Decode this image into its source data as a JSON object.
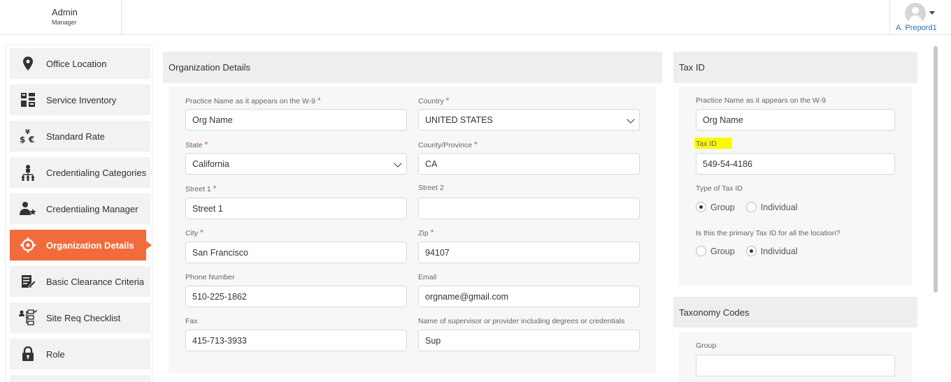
{
  "header": {
    "app_title": "Admin",
    "app_subtitle": "Manager",
    "user_name": "A. Prepord1"
  },
  "sidebar": {
    "items": [
      {
        "label": "Office Location",
        "icon": "map-pin-icon",
        "active": false
      },
      {
        "label": "Service Inventory",
        "icon": "inventory-icon",
        "active": false
      },
      {
        "label": "Standard Rate",
        "icon": "currency-icon",
        "active": false
      },
      {
        "label": "Credentialing Categories",
        "icon": "org-chart-icon",
        "active": false
      },
      {
        "label": "Credentialing Manager",
        "icon": "user-star-icon",
        "active": false
      },
      {
        "label": "Organization Details",
        "icon": "crosshair-icon",
        "active": true
      },
      {
        "label": "Basic Clearance Criteria",
        "icon": "edit-document-icon",
        "active": false
      },
      {
        "label": "Site Req Checklist",
        "icon": "checklist-icon",
        "active": false
      },
      {
        "label": "Role",
        "icon": "lock-icon",
        "active": false
      }
    ]
  },
  "org_details": {
    "title": "Organization Details",
    "practice_name_label": "Practice Name as it appears on the W-9",
    "practice_name_value": "Org Name",
    "country_label": "Country",
    "country_value": "UNITED STATES",
    "state_label": "State",
    "state_value": "California",
    "county_label": "County/Province",
    "county_value": "CA",
    "street1_label": "Street 1",
    "street1_value": "Street 1",
    "street2_label": "Street 2",
    "street2_value": "",
    "city_label": "City",
    "city_value": "San Francisco",
    "zip_label": "Zip",
    "zip_value": "94107",
    "phone_label": "Phone Number",
    "phone_value": "510-225-1862",
    "email_label": "Email",
    "email_value": "orgname@gmail.com",
    "fax_label": "Fax",
    "fax_value": "415-713-3933",
    "supervisor_label": "Name of supervisor or provider including degrees or credentials",
    "supervisor_value": "Sup",
    "required_mark": "*"
  },
  "tax_id": {
    "title": "Tax ID",
    "practice_name_label": "Practice Name as it appears on the W-9",
    "practice_name_value": "Org Name",
    "tax_id_label": "Tax ID",
    "tax_id_value": "549-54-4186",
    "type_label": "Type of Tax ID",
    "type_options": [
      "Group",
      "Individual"
    ],
    "type_selected": "Group",
    "primary_label": "Is this the primary Tax ID for all the location?",
    "primary_options": [
      "Group",
      "Individual"
    ],
    "primary_selected": "Individual"
  },
  "taxonomy": {
    "title": "Taxonomy Codes",
    "group_label": "Group",
    "group_value": ""
  },
  "colors": {
    "accent": "#f26b3a",
    "highlight": "#fafa00",
    "link": "#2a6ebb",
    "required": "#e04b4b"
  }
}
